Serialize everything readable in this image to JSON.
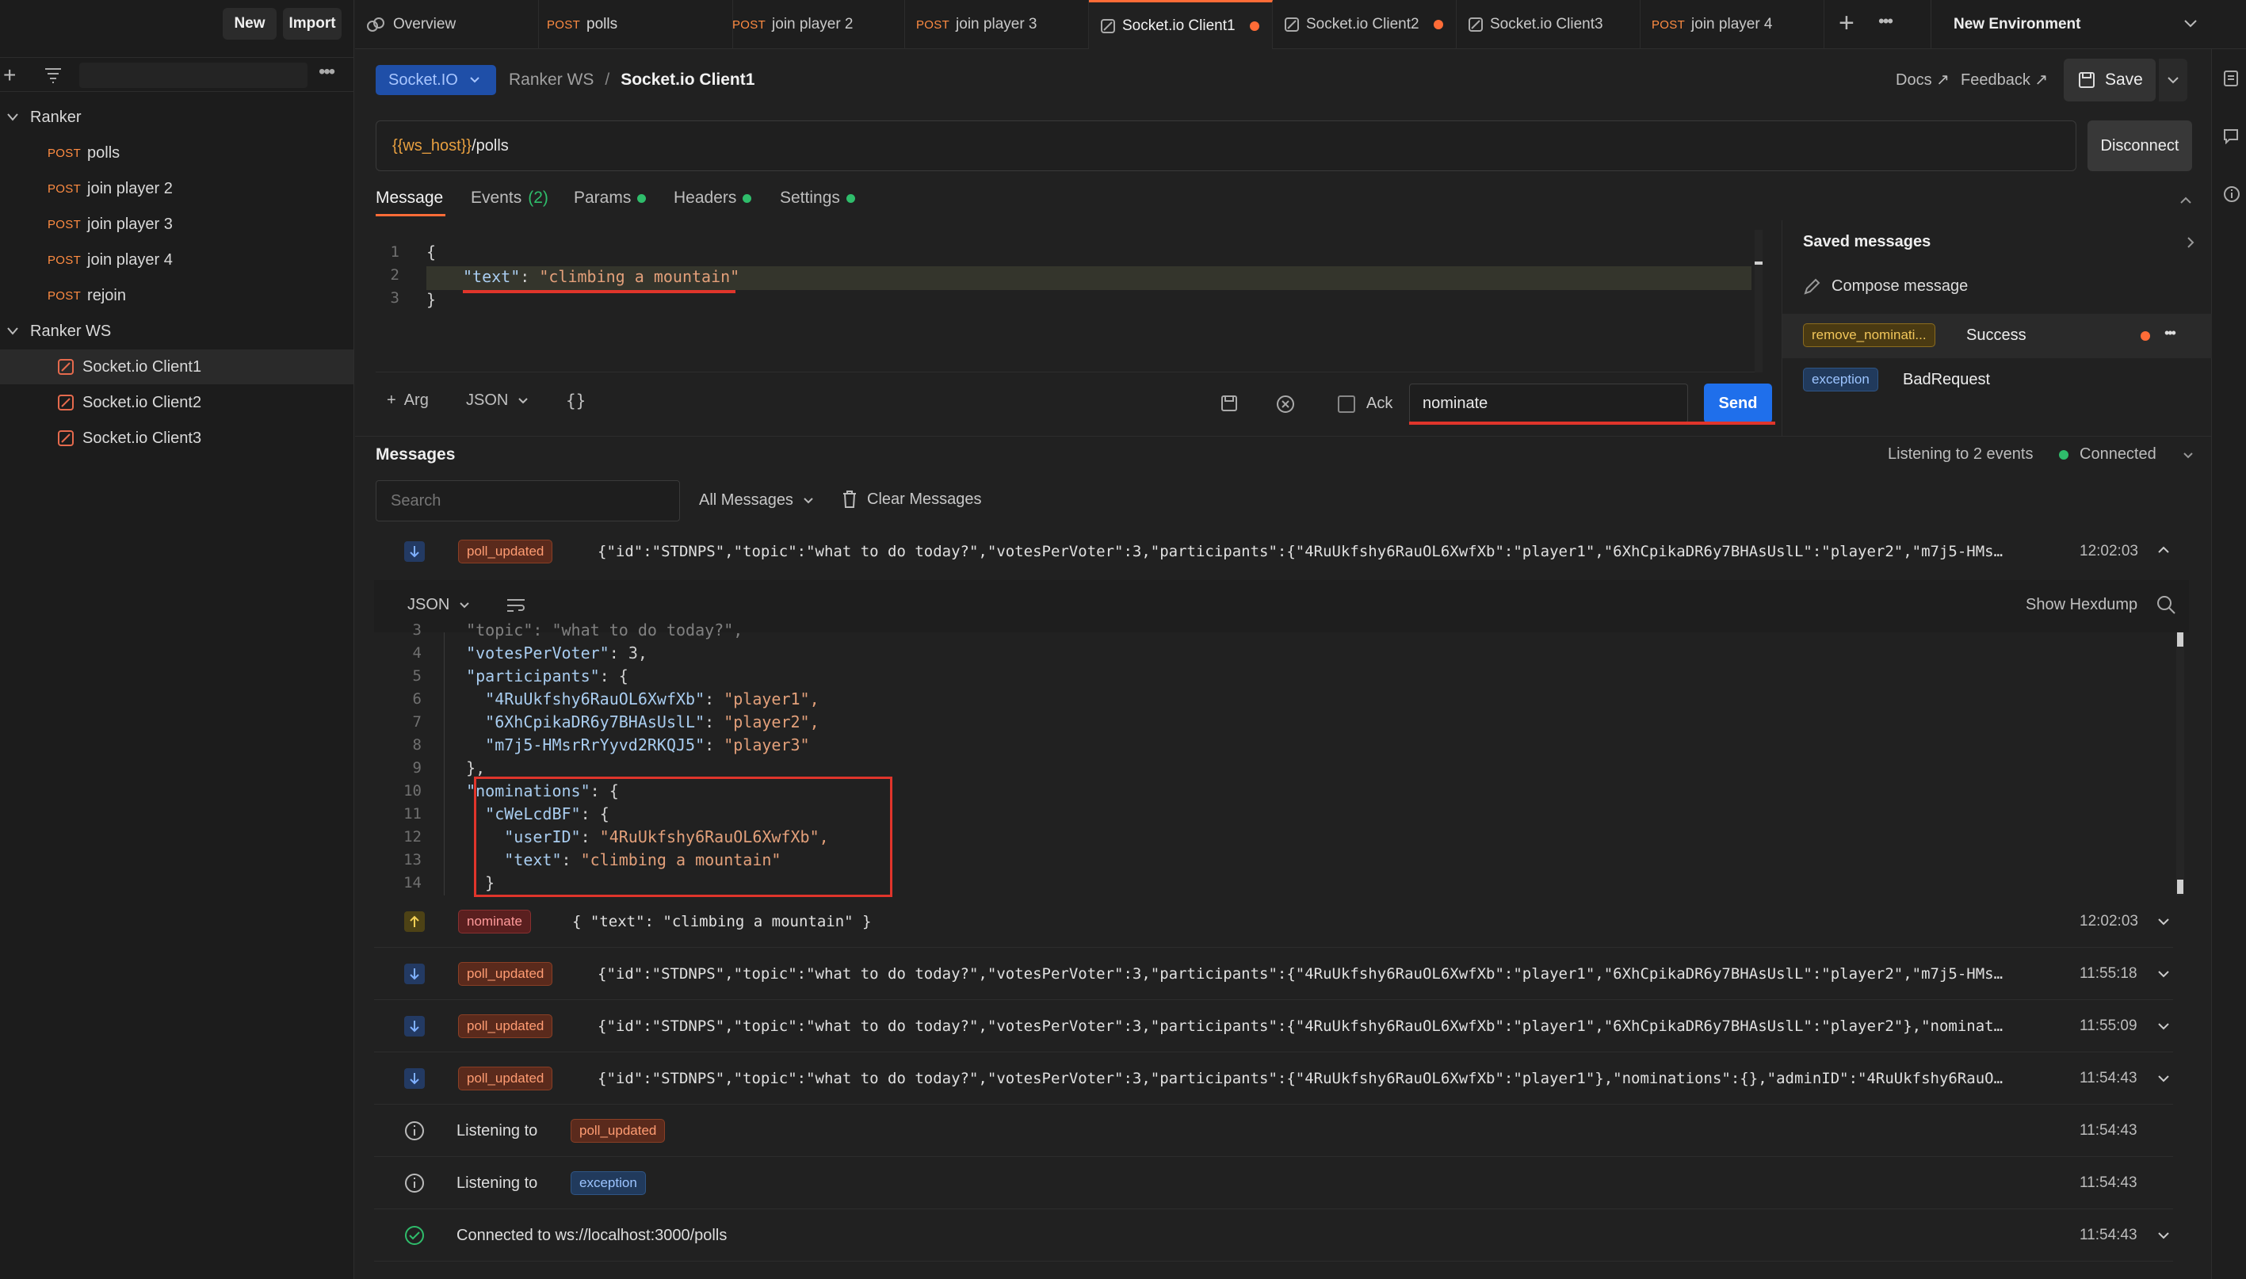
{
  "sidebar": {
    "new_label": "New",
    "import_label": "Import",
    "collections": [
      {
        "name": "Ranker",
        "items": [
          {
            "method": "POST",
            "label": "polls"
          },
          {
            "method": "POST",
            "label": "join player 2"
          },
          {
            "method": "POST",
            "label": "join player 3"
          },
          {
            "method": "POST",
            "label": "join player 4"
          },
          {
            "method": "POST",
            "label": "rejoin"
          }
        ]
      },
      {
        "name": "Ranker WS",
        "items": [
          {
            "label": "Socket.io Client1"
          },
          {
            "label": "Socket.io Client2"
          },
          {
            "label": "Socket.io Client3"
          }
        ]
      }
    ]
  },
  "tabs": [
    {
      "method": "",
      "label": "Overview"
    },
    {
      "method": "POST",
      "label": "polls"
    },
    {
      "method": "POST",
      "label": "join player 2"
    },
    {
      "method": "POST",
      "label": "join player 3"
    },
    {
      "method": "",
      "label": "Socket.io Client1"
    },
    {
      "method": "",
      "label": "Socket.io Client2"
    },
    {
      "method": "",
      "label": "Socket.io Client3"
    },
    {
      "method": "POST",
      "label": "join player 4"
    }
  ],
  "environment": "New Environment",
  "request": {
    "protocol": "Socket.IO",
    "breadcrumb_parent": "Ranker WS",
    "breadcrumb_sep": "/",
    "breadcrumb_current": "Socket.io Client1",
    "docs": "Docs ↗",
    "feedback": "Feedback ↗",
    "save": "Save",
    "url_var": "{{ws_host}}",
    "url_path": "/polls",
    "disconnect": "Disconnect"
  },
  "subtabs": {
    "message": "Message",
    "events": "Events",
    "events_count": "(2)",
    "params": "Params",
    "headers": "Headers",
    "settings": "Settings"
  },
  "editor": {
    "lines": [
      "1",
      "2",
      "3"
    ],
    "open": "{",
    "key": "\"text\"",
    "colon": ": ",
    "value": "\"climbing a mountain\"",
    "close": "}"
  },
  "compose_bar": {
    "arg": "+  Arg",
    "format": "JSON",
    "braces": "{}",
    "ack": "Ack",
    "event_name": "nominate",
    "send": "Send"
  },
  "saved": {
    "title": "Saved messages",
    "compose": "Compose message",
    "items": [
      {
        "tag": "remove_nominati...",
        "name": "Success"
      },
      {
        "tag": "exception",
        "name": "BadRequest"
      }
    ]
  },
  "messages": {
    "title": "Messages",
    "listening": "Listening to 2 events",
    "status": "Connected",
    "search_placeholder": "Search",
    "filter": "All Messages",
    "clear": "Clear Messages",
    "expanded": {
      "event": "poll_updated",
      "text": "{\"id\":\"STDNPS\",\"topic\":\"what to do today?\",\"votesPerVoter\":3,\"participants\":{\"4RuUkfshy6RauOL6XwfXb\":\"player1\",\"6XhCpikaDR6y7BHAsUslL\":\"player2\",\"m7j5-HMs…",
      "time": "12:02:03",
      "format": "JSON",
      "hexdump": "Show Hexdump",
      "code": [
        {
          "n": "3",
          "text": "  \"topic\": \"what to do today?\","
        },
        {
          "n": "4",
          "key": "\"votesPerVoter\"",
          "val": "3,",
          "indent": "  "
        },
        {
          "n": "5",
          "key": "\"participants\"",
          "val": "{",
          "indent": "  "
        },
        {
          "n": "6",
          "key": "\"4RuUkfshy6RauOL6XwfXb\"",
          "val": "\"player1\",",
          "indent": "    "
        },
        {
          "n": "7",
          "key": "\"6XhCpikaDR6y7BHAsUslL\"",
          "val": "\"player2\",",
          "indent": "    "
        },
        {
          "n": "8",
          "key": "\"m7j5-HMsrRrYyvd2RKQJ5\"",
          "val": "\"player3\"",
          "indent": "    "
        },
        {
          "n": "9",
          "text": "  },"
        },
        {
          "n": "10",
          "key": "\"nominations\"",
          "val": "{",
          "indent": "  "
        },
        {
          "n": "11",
          "key": "\"cWeLcdBF\"",
          "val": "{",
          "indent": "    "
        },
        {
          "n": "12",
          "key": "\"userID\"",
          "val": "\"4RuUkfshy6RauOL6XwfXb\",",
          "indent": "      "
        },
        {
          "n": "13",
          "key": "\"text\"",
          "val": "\"climbing a mountain\"",
          "indent": "      "
        },
        {
          "n": "14",
          "text": "    }"
        }
      ]
    },
    "rows": [
      {
        "event": "nominate",
        "text": "{ \"text\": \"climbing a mountain\" }",
        "time": "12:02:03"
      },
      {
        "event": "poll_updated",
        "text": "{\"id\":\"STDNPS\",\"topic\":\"what to do today?\",\"votesPerVoter\":3,\"participants\":{\"4RuUkfshy6RauOL6XwfXb\":\"player1\",\"6XhCpikaDR6y7BHAsUslL\":\"player2\",\"m7j5-HMs…",
        "time": "11:55:18"
      },
      {
        "event": "poll_updated",
        "text": "{\"id\":\"STDNPS\",\"topic\":\"what to do today?\",\"votesPerVoter\":3,\"participants\":{\"4RuUkfshy6RauOL6XwfXb\":\"player1\",\"6XhCpikaDR6y7BHAsUslL\":\"player2\"},\"nominat…",
        "time": "11:55:09"
      },
      {
        "event": "poll_updated",
        "text": "{\"id\":\"STDNPS\",\"topic\":\"what to do today?\",\"votesPerVoter\":3,\"participants\":{\"4RuUkfshy6RauOL6XwfXb\":\"player1\"},\"nominations\":{},\"adminID\":\"4RuUkfshy6RauO…",
        "time": "11:54:43"
      }
    ],
    "info_rows": [
      {
        "label": "Listening to",
        "event": "poll_updated",
        "time": "11:54:43"
      },
      {
        "label": "Listening to",
        "event": "exception",
        "time": "11:54:43"
      },
      {
        "label": "Connected to ws://localhost:3000/polls",
        "time": "11:54:43"
      }
    ]
  },
  "colors": {
    "accent": "#ff6c37",
    "send": "#1f6feb",
    "connected": "#2fbd6b",
    "annotation": "#e0352b"
  }
}
